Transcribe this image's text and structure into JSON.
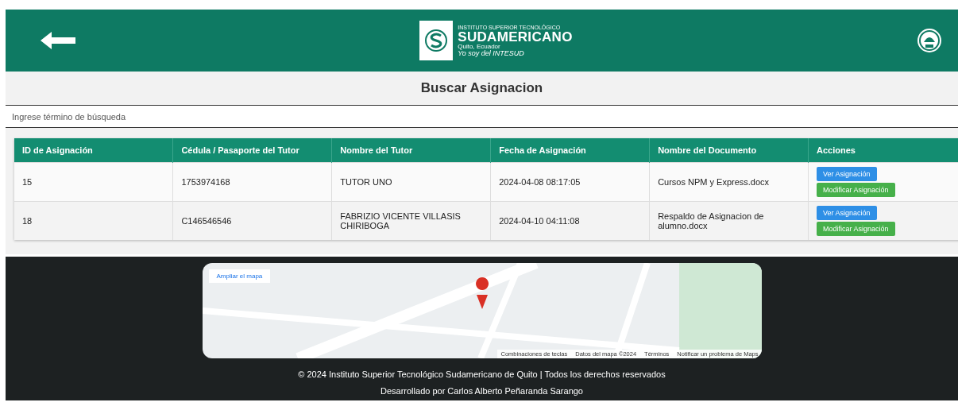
{
  "header": {
    "logo": {
      "line_1": "INSTITUTO SUPERIOR TECNOLÓGICO",
      "line_2": "SUDAMERICANO",
      "line_3": "Quito, Ecuador",
      "slogan": "Yo soy del INTESUD"
    }
  },
  "title": "Buscar Asignacion",
  "search": {
    "placeholder": "Ingrese término de búsqueda"
  },
  "table": {
    "columns": [
      "ID de Asignación",
      "Cédula / Pasaporte del Tutor",
      "Nombre del Tutor",
      "Fecha de Asignación",
      "Nombre del Documento",
      "Acciones"
    ],
    "rows": [
      {
        "cells": [
          "15",
          "1753974168",
          "TUTOR UNO",
          "2024-04-08 08:17:05",
          "Cursos NPM y Express.docx"
        ],
        "actions": [
          {
            "kind": "view",
            "label": "Ver Asignación"
          },
          {
            "kind": "edit",
            "label": "Modificar Asignación"
          }
        ]
      },
      {
        "cells": [
          "18",
          "C146546546",
          "FABRIZIO VICENTE VILLASIS CHIRIBOGA",
          "2024-04-10 04:11:08",
          "Respaldo de Asignacion de alumno.docx"
        ],
        "actions": [
          {
            "kind": "view",
            "label": "Ver Asignación"
          },
          {
            "kind": "edit",
            "label": "Modificar Asignación"
          }
        ]
      }
    ]
  },
  "footer": {
    "map": {
      "expand_link": "Ampliar el mapa",
      "attribution": [
        "Combinaciones de teclas",
        "Datos del mapa ©2024",
        "Términos",
        "Notificar un problema de Maps"
      ]
    },
    "copyright": "© 2024 Instituto Superior Tecnológico Sudamericano de Quito | Todos los derechos reservados",
    "credit": "Desarrollado por Carlos Alberto Peñaranda Sarango"
  }
}
